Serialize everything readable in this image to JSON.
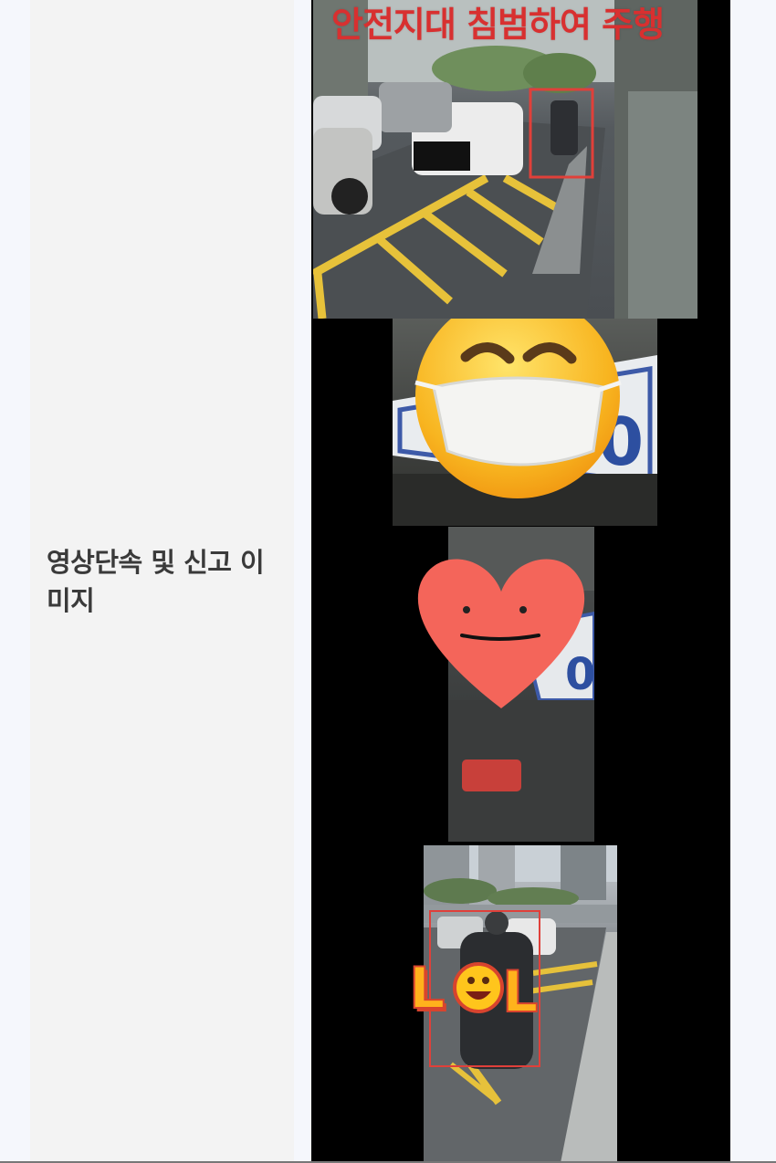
{
  "row": {
    "label": "영상단속 및 신고 이미지"
  },
  "media": {
    "caption_overlay": "안전지대 침범하여 주행",
    "stickers": [
      "mask-face-emoji-icon",
      "smiling-heart-icon",
      "lol-sticker-icon"
    ],
    "lol_text": "LOL"
  },
  "colors": {
    "label_cell": "#f3f3f3",
    "page_bg": "#f5f7fc",
    "caption_red": "#d83030",
    "highlight_box": "#e0403a",
    "heart": "#f4655a"
  }
}
